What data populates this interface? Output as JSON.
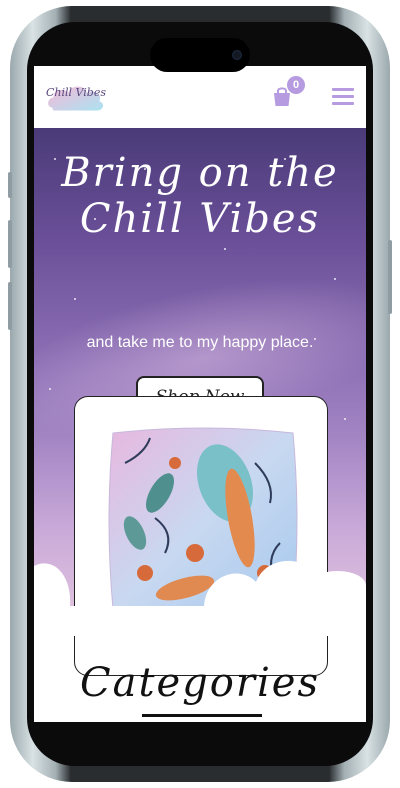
{
  "header": {
    "logo_text": "Chill Vibes",
    "cart_count": "0",
    "cart_icon": "shopping-bag-icon",
    "menu_icon": "hamburger-menu-icon"
  },
  "hero": {
    "title": "Bring on the Chill Vibes",
    "subtitle": "and take me to my happy place.",
    "cta_label": "Shop Now"
  },
  "product": {
    "image": "pillow-image"
  },
  "sections": {
    "categories_title": "Categories"
  },
  "colors": {
    "accent": "#b69be0",
    "hero_top": "#4a3b78",
    "hero_bottom": "#e3c6e0"
  }
}
